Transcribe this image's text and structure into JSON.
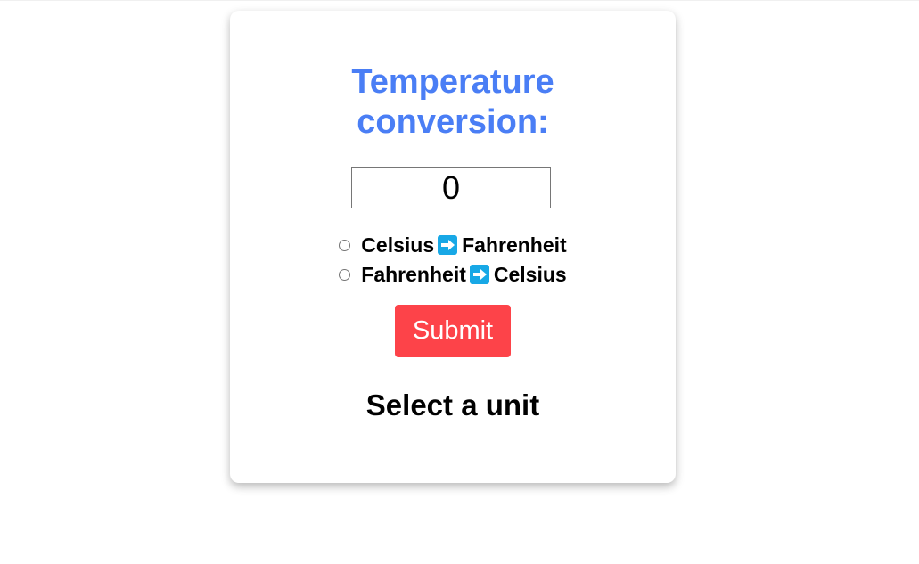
{
  "title": {
    "line1": "Temperature",
    "line2": "conversion:"
  },
  "input": {
    "value": "0"
  },
  "options": [
    {
      "from": "Celsius",
      "to": "Fahrenheit",
      "icon": "right-arrow-icon"
    },
    {
      "from": "Fahrenheit",
      "to": "Celsius",
      "icon": "right-arrow-icon"
    }
  ],
  "submit": {
    "label": "Submit"
  },
  "result": {
    "text": "Select a unit"
  },
  "colors": {
    "title": "#4a7ef5",
    "submit": "#fd4349",
    "arrow_icon": "#18a8e6"
  }
}
